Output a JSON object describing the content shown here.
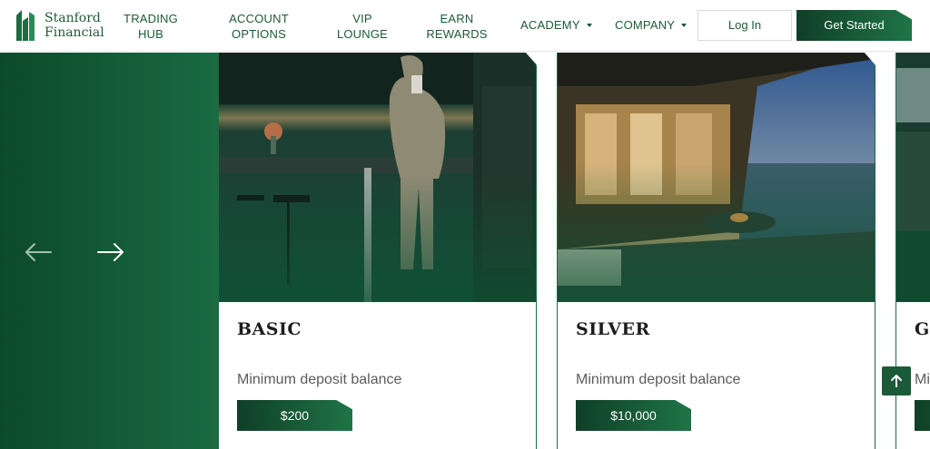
{
  "brand": {
    "line1": "Stanford",
    "line2": "Financial"
  },
  "nav": {
    "trading_hub": [
      "TRADING",
      "HUB"
    ],
    "account_options": [
      "ACCOUNT",
      "OPTIONS"
    ],
    "vip_lounge": [
      "VIP",
      "LOUNGE"
    ],
    "earn_rewards": [
      "EARN",
      "REWARDS"
    ],
    "academy": "ACADEMY",
    "company": "COMPANY"
  },
  "buttons": {
    "login": "Log In",
    "get_started": "Get Started"
  },
  "cards": [
    {
      "title": "BASIC",
      "subtitle": "Minimum deposit balance",
      "price": "$200"
    },
    {
      "title": "SILVER",
      "subtitle": "Minimum deposit balance",
      "price": "$10,000"
    },
    {
      "title": "G",
      "subtitle": "Mi",
      "price": ""
    }
  ],
  "icons": {
    "logo": "stanford-logo-mark",
    "prev": "arrow-left-icon",
    "next": "arrow-right-icon",
    "scroll_top": "arrow-up-icon",
    "dropdown": "caret-down-icon"
  },
  "colors": {
    "brand_green": "#1c5a38",
    "panel_green": "#0c4a2a",
    "gradient_start": "#0f3f27",
    "gradient_end": "#1f7447"
  }
}
